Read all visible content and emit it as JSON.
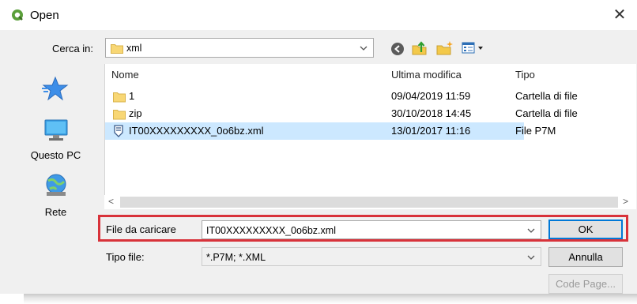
{
  "window": {
    "title": "Open",
    "close_glyph": "✕"
  },
  "look_in": {
    "label": "Cerca in:",
    "value": "xml"
  },
  "toolbar": {
    "icons": [
      "back-icon",
      "up-folder-icon",
      "new-folder-icon",
      "view-menu-icon"
    ]
  },
  "sidebar": {
    "items": [
      {
        "label": "",
        "icon": "quick-access-star-icon"
      },
      {
        "label": "Questo PC",
        "icon": "this-pc-icon"
      },
      {
        "label": "Rete",
        "icon": "network-icon"
      }
    ]
  },
  "file_list": {
    "columns": [
      "Nome",
      "Ultima modifica",
      "Tipo"
    ],
    "rows": [
      {
        "name": "1",
        "modified": "09/04/2019 11:59",
        "type": "Cartella di file",
        "icon": "folder-icon"
      },
      {
        "name": "zip",
        "modified": "30/10/2018 14:45",
        "type": "Cartella di file",
        "icon": "folder-icon"
      },
      {
        "name": "IT00XXXXXXXXX_0o6bz.xml",
        "modified": "13/01/2017 11:16",
        "type": "File P7M",
        "icon": "signed-file-icon"
      }
    ]
  },
  "scrollbar": {
    "left": "<",
    "right": ">"
  },
  "file_name": {
    "label": "File da caricare",
    "value": "IT00XXXXXXXXX_0o6bz.xml"
  },
  "file_type": {
    "label": "Tipo file:",
    "value": "*.P7M; *.XML"
  },
  "buttons": {
    "ok": "OK",
    "cancel": "Annulla",
    "code_page": "Code Page..."
  },
  "colors": {
    "selection": "#cce8ff",
    "highlight_border": "#d8323a",
    "accent": "#0078d7"
  }
}
